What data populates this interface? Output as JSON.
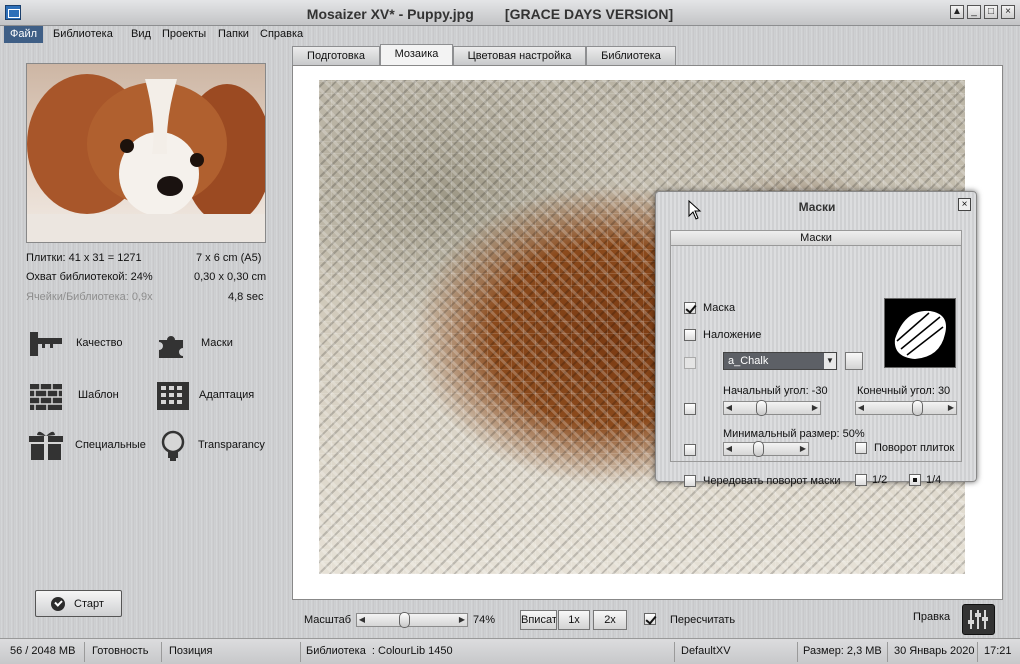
{
  "window": {
    "title": "Mosaizer XV* - Puppy.jpg        [GRACE DAYS VERSION]",
    "buttons": [
      "▲",
      "_",
      "□",
      "×"
    ]
  },
  "menu": [
    "Файл",
    "Библиотека",
    "Вид",
    "Проекты",
    "Папки",
    "Справка"
  ],
  "tabs": [
    "Подготовка",
    "Мозаика",
    "Цветовая настройка",
    "Библиотека"
  ],
  "info": {
    "tiles": "Плитки: 41 x 31 = 1271",
    "size": "7 x 6 cm  (A5)",
    "coverage": "Охват библиотекой: 24%",
    "tile_size": "0,30 x 0,30 cm",
    "cells": "Ячейки/Библиотека: 0,9x",
    "time": "4,8 sec"
  },
  "tools": {
    "quality": "Качество",
    "masks": "Маски",
    "template": "Шаблон",
    "adaptation": "Адаптация",
    "special": "Специальные",
    "transparency": "Transparancy"
  },
  "start_label": "Старт",
  "bottom": {
    "zoom_label": "Масштаб",
    "zoom_value": "74%",
    "zoom_fraction": 0.74,
    "fit_label": "Вписать",
    "x1_label": "1x",
    "x2_label": "2x",
    "recalc_label": "Пересчитать",
    "edit_label": "Правка"
  },
  "status": {
    "memory": "56 / 2048 MB",
    "ready": "Готовность",
    "position": "Позиция",
    "library": "Библиотека  : ColourLib 1450",
    "preset": "DefaultXV",
    "size": "Размер: 2,3 MB",
    "date": "30 Январь 2020",
    "time": "17:21"
  },
  "dialog": {
    "title": "Маски",
    "header": "Маски",
    "mask_label": "Маска",
    "overlay_label": "Наложение",
    "mask_name": "a_Chalk",
    "start_angle": "Начальный угол: -30",
    "end_angle": "Конечный угол: 30",
    "start_angle_value": -30,
    "end_angle_value": 30,
    "min_size": "Минимальный размер: 50%",
    "min_size_value": 0.5,
    "rotate_tiles": "Поворот плиток",
    "alternate": "Чередовать поворот маски",
    "half": "1/2",
    "quarter": "1/4"
  }
}
